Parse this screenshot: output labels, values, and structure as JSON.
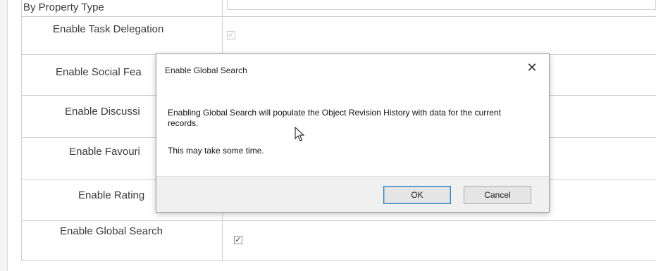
{
  "settings": {
    "rows": [
      {
        "label": "By Property Type",
        "value": null
      },
      {
        "label": "Enable Task Delegation",
        "value": "checked-disabled"
      },
      {
        "label": "Enable Social Fea",
        "value": null
      },
      {
        "label": "Enable Discussi",
        "value": null
      },
      {
        "label": "Enable Favouri",
        "value": null
      },
      {
        "label": "Enable Rating",
        "value": null
      },
      {
        "label": "Enable Global Search",
        "value": "checked"
      }
    ]
  },
  "dialog": {
    "title": "Enable Global Search",
    "close_icon": "close-icon",
    "message": "Enabling Global Search will populate the Object Revision History with data for the current records.",
    "note": "This may take some time.",
    "ok_label": "OK",
    "cancel_label": "Cancel"
  },
  "colors": {
    "ok_border": "#3c7fb1",
    "footer_bg": "#f0f0f0"
  }
}
